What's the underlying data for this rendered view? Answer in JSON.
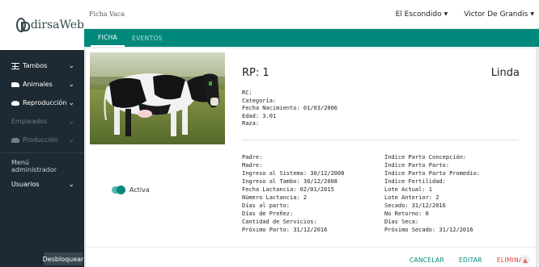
{
  "brand": {
    "name": "dirsaWeb"
  },
  "sidebar": {
    "items": [
      {
        "label": "Tambos",
        "icon": "table-icon",
        "enabled": true,
        "has_chevron": true
      },
      {
        "label": "Animales",
        "icon": "cow-icon",
        "enabled": true,
        "has_chevron": true
      },
      {
        "label": "Reproducción",
        "icon": "reproduction-icon",
        "enabled": true,
        "has_chevron": true
      },
      {
        "label": "Empleados",
        "icon": "",
        "enabled": false,
        "has_chevron": true
      },
      {
        "label": "Producción",
        "icon": "production-icon",
        "enabled": false,
        "has_chevron": true
      }
    ],
    "admin_label": "Menú administrador",
    "users_label": "Usuarios",
    "unlock_label": "Desbloquear"
  },
  "header": {
    "title": "Ficha Vaca",
    "establishment": "El Escondido",
    "user": "Victor De Grandis"
  },
  "tabs": [
    {
      "label": "FICHA",
      "active": true
    },
    {
      "label": "EVENTOS",
      "active": false
    }
  ],
  "animal": {
    "rp": "RP: 1",
    "name": "Linda",
    "status_label": "Activa",
    "status_active": true,
    "info": [
      "RC:",
      "Categoría:",
      "Fecha Nacimiento: 01/03/2006",
      "Edad: 3.01",
      "Raza:"
    ],
    "details_left": [
      "Padre:",
      "Madre:",
      "Ingreso al Sistema: 30/12/2008",
      "Ingreso al Tambo: 30/12/2008",
      "Fecha Lactancia: 02/01/2015",
      "Número Lactancia: 2",
      "Días al parto:",
      "Días de Preñez:",
      "Cantidad de Servicios:",
      "Próximo Parto: 31/12/2016"
    ],
    "details_right": [
      "Índice Parto Concepción:",
      "Índice Parto Parto:",
      "Índice Parto Parto Promedio:",
      "Índice Fertilidad:",
      "Lote Actual: 1",
      "Lote Anterior: 2",
      "Secado: 31/12/2016",
      "No Retorno: 0",
      "Días Seca:",
      "Próximo Secado: 31/12/2016"
    ]
  },
  "actions": {
    "cancel": "CANCELAR",
    "edit": "EDITAR",
    "delete": "ELIMINAR"
  },
  "colors": {
    "accent": "#00897b",
    "sidebar": "#1d2a33",
    "danger": "#e53935"
  }
}
